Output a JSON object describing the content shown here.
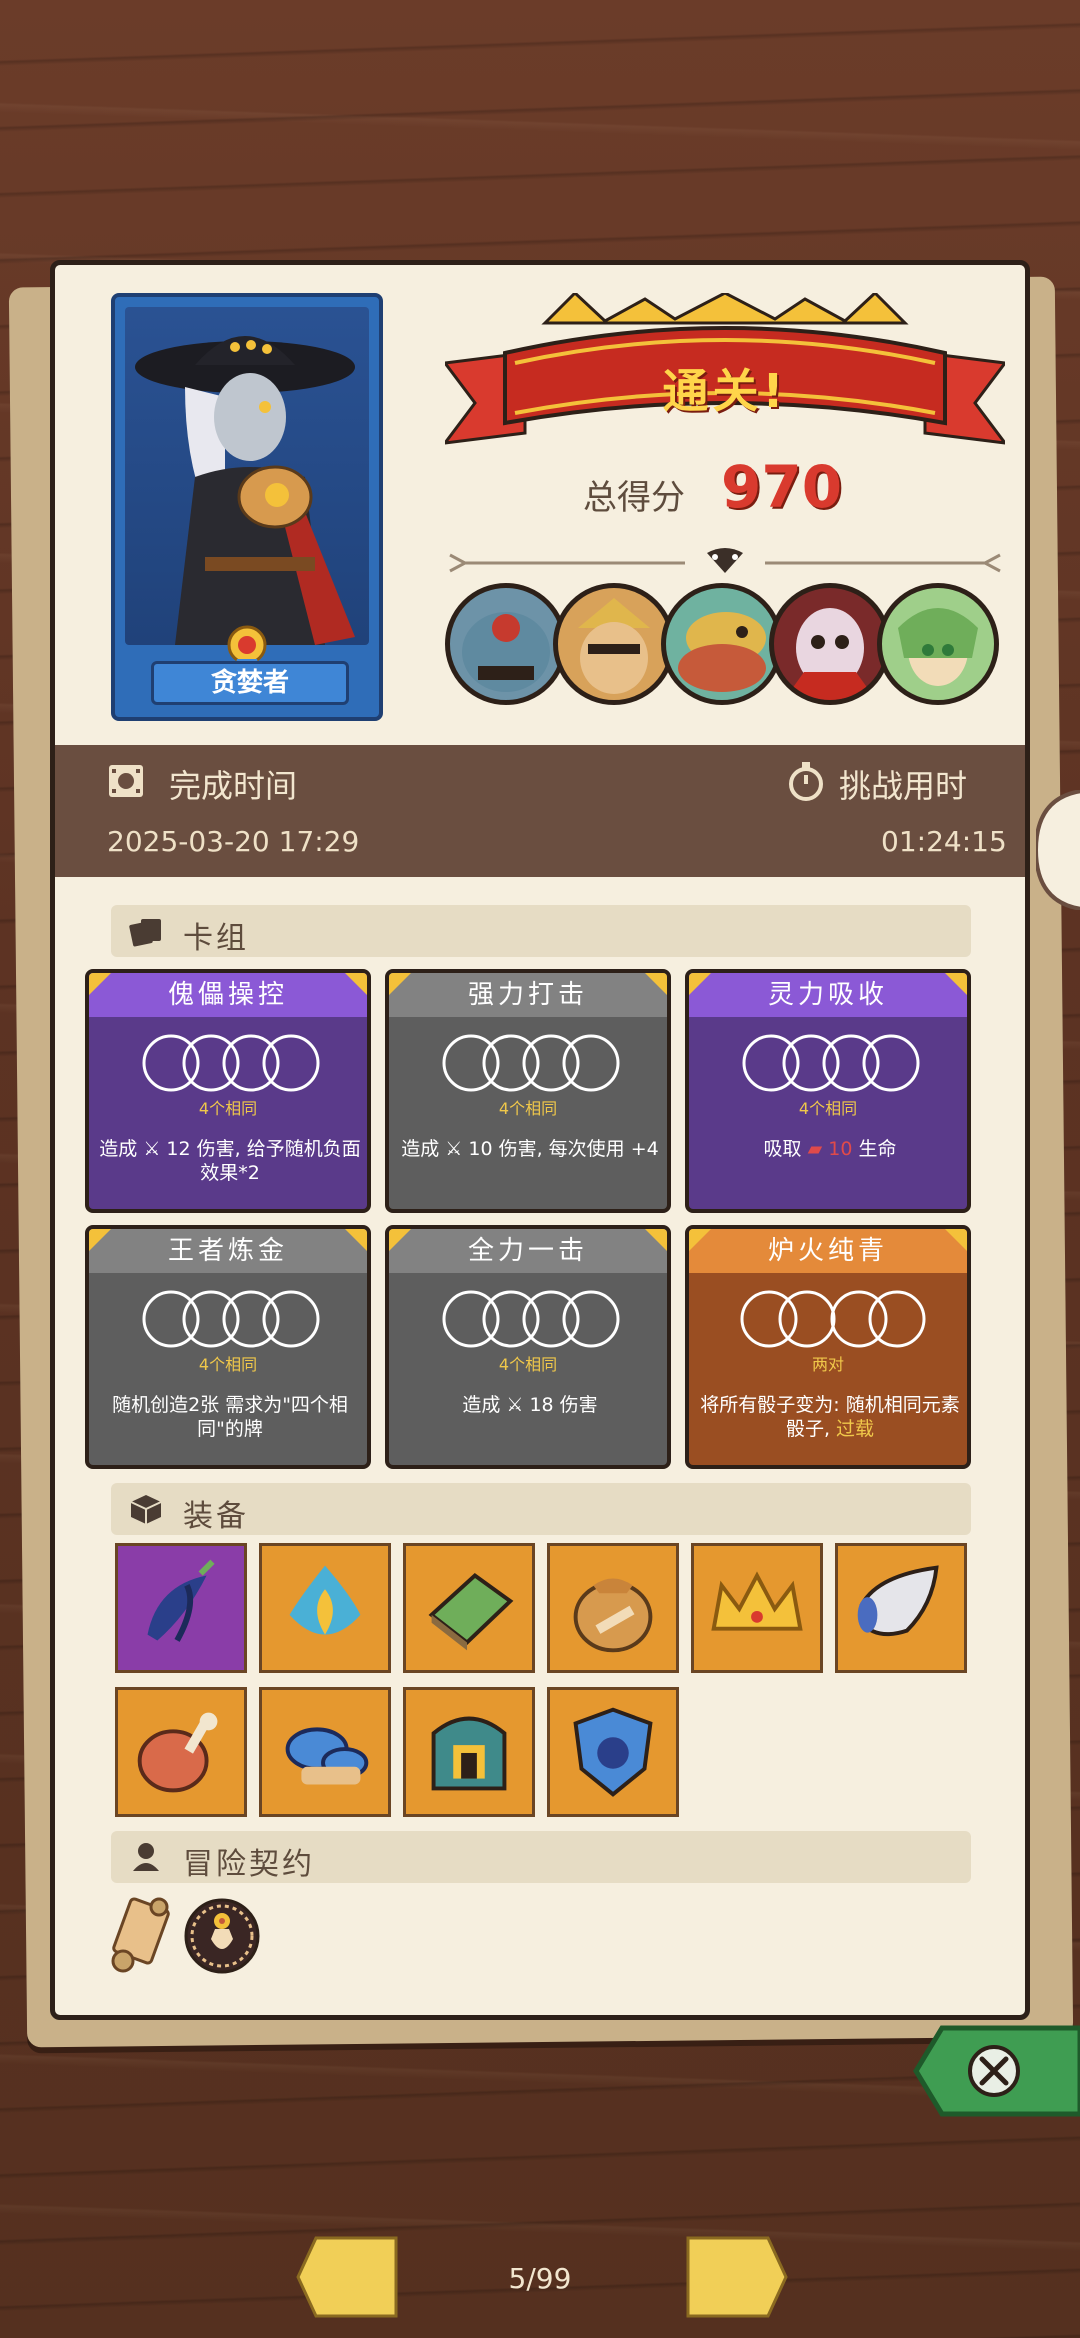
{
  "result": {
    "banner": "通关!",
    "score_label": "总得分",
    "score_value": "970"
  },
  "hero": {
    "name": "贪婪者"
  },
  "info": {
    "finish_time_label": "完成时间",
    "finish_time_value": "2025-03-20  17:29",
    "challenge_time_label": "挑战用时",
    "challenge_time_value": "01:24:15"
  },
  "sections": {
    "deck": "卡组",
    "equipment": "装备",
    "contract": "冒险契约"
  },
  "cards": [
    {
      "title": "傀儡操控",
      "condition": "4个相同",
      "desc_pre": "造成",
      "desc_num": "12",
      "desc_post": "伤害, 给予随机负面效果*2",
      "color": "purple"
    },
    {
      "title": "强力打击",
      "condition": "4个相同",
      "desc_pre": "造成",
      "desc_num": "10",
      "desc_post": "伤害, 每次使用 +4",
      "color": "gray"
    },
    {
      "title": "灵力吸收",
      "condition": "4个相同",
      "desc_pre": "吸取",
      "desc_num": "10",
      "desc_post": "生命",
      "color": "purple"
    },
    {
      "title": "王者炼金",
      "condition": "4个相同",
      "desc_pre": "",
      "desc_num": "",
      "desc_post": "随机创造2张 需求为\"四个相同\"的牌",
      "color": "gray"
    },
    {
      "title": "全力一击",
      "condition": "4个相同",
      "desc_pre": "造成",
      "desc_num": "18",
      "desc_post": "伤害",
      "color": "gray"
    },
    {
      "title": "炉火纯青",
      "condition": "两对",
      "desc_pre": "",
      "desc_num": "",
      "desc_post": "将所有骰子变为: 随机相同元素骰子,",
      "desc_highlight": "过载",
      "color": "orange"
    }
  ],
  "equipment_icons": [
    "feather-icon",
    "flame-crystal-icon",
    "moss-book-icon",
    "coin-bag-icon",
    "crown-icon",
    "horn-icon",
    "meat-icon",
    "mushroom-icon",
    "helmet-icon",
    "shield-icon"
  ],
  "contract_icons": [
    "scroll-icon",
    "flower-vase-icon"
  ],
  "nav": {
    "page": "5/99"
  },
  "colors": {
    "purple_card": "#5a3a8a",
    "gray_card": "#5e5e5e",
    "orange_card": "#9a4e22",
    "score_red": "#d93a2e",
    "condition_yellow": "#f0c84a"
  }
}
